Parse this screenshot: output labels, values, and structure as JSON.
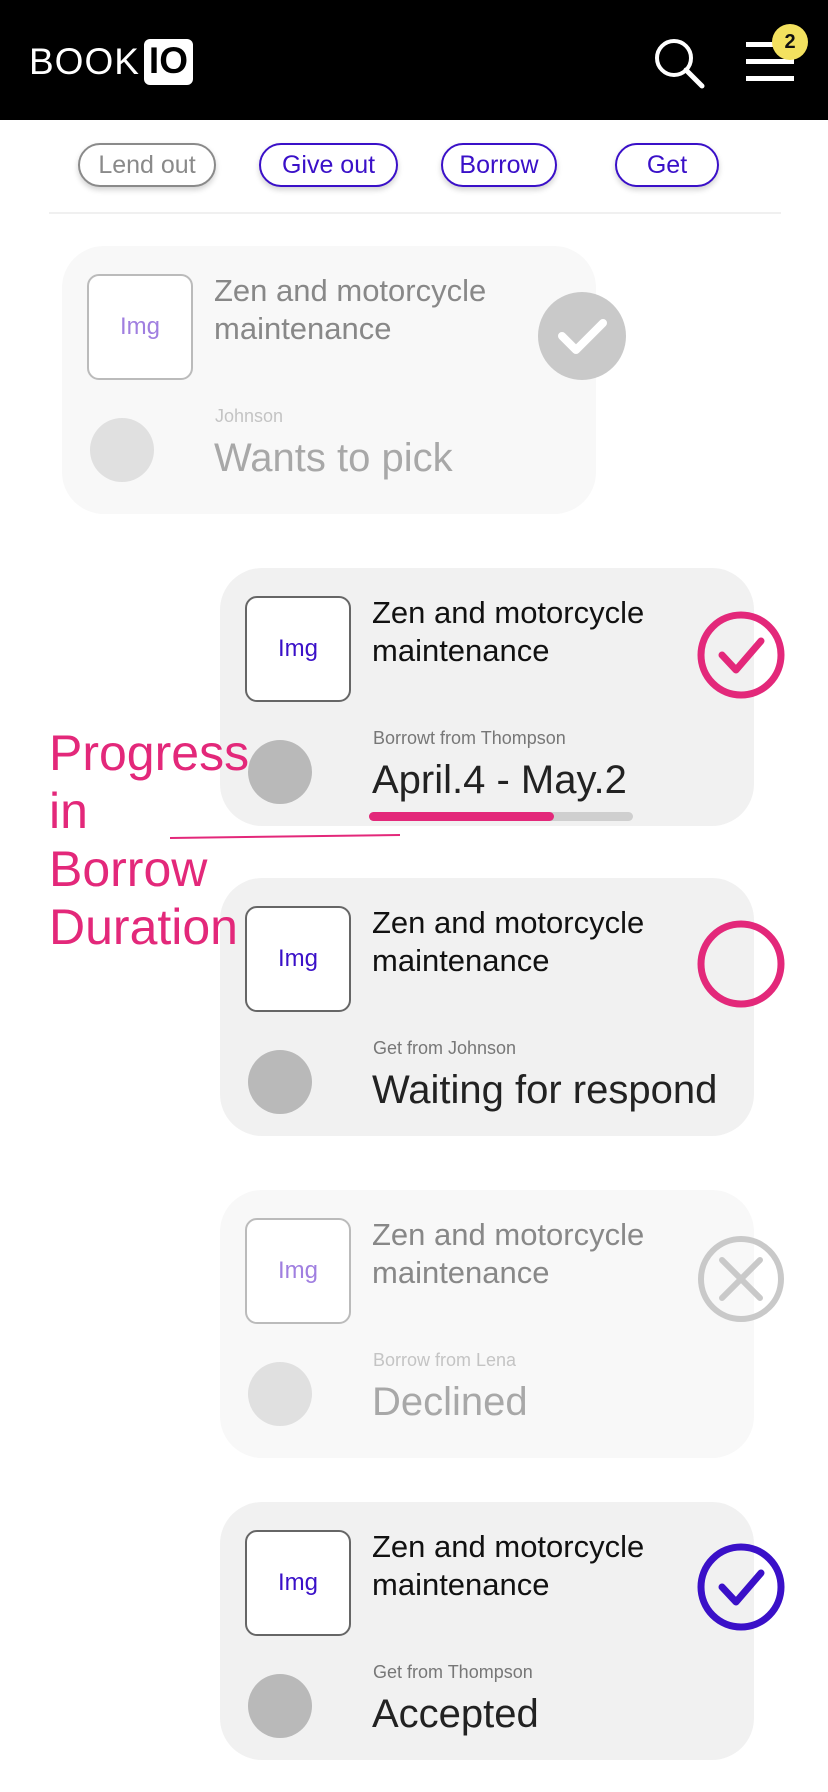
{
  "header": {
    "logo_text": "BOOK",
    "logo_box": "IO",
    "notification_count": "2",
    "icons": {
      "search": "search-icon",
      "menu": "hamburger-menu-icon"
    }
  },
  "tabs": [
    {
      "label": "Lend out",
      "active": true
    },
    {
      "label": "Give out",
      "active": false
    },
    {
      "label": "Borrow",
      "active": false
    },
    {
      "label": "Get",
      "active": false
    }
  ],
  "annotation": {
    "text_1": "Progress",
    "text_2": "in",
    "text_3": "Borrow",
    "text_4": "Duration"
  },
  "cards": [
    {
      "thumb": "Img",
      "title_1": "Zen and motorcycle",
      "title_2": "maintenance",
      "subtitle": "Johnson",
      "status": "Wants to pick",
      "action_icon": "grey-check-circle-icon"
    },
    {
      "thumb": "Img",
      "title_1": "Zen and motorcycle",
      "title_2": "maintenance",
      "subtitle": "Borrowt from Thompson",
      "status": "April.4 - May.2",
      "progress": 0.7,
      "action_icon": "pink-check-circle-icon"
    },
    {
      "thumb": "Img",
      "title_1": "Zen and motorcycle",
      "title_2": "maintenance",
      "subtitle": "Get  from Johnson",
      "status": "Waiting for respond",
      "action_icon": "pink-empty-circle-icon"
    },
    {
      "thumb": "Img",
      "title_1": "Zen and motorcycle",
      "title_2": "maintenance",
      "subtitle": "Borrow from Lena",
      "status": "Declined",
      "action_icon": "grey-x-circle-icon"
    },
    {
      "thumb": "Img",
      "title_1": "Zen and motorcycle",
      "title_2": "maintenance",
      "subtitle": "Get from Thompson",
      "status": "Accepted",
      "action_icon": "purple-check-circle-icon"
    }
  ],
  "colors": {
    "accent_pink": "#e3287a",
    "accent_purple": "#3a10c8",
    "badge_yellow": "#f3e15f"
  }
}
